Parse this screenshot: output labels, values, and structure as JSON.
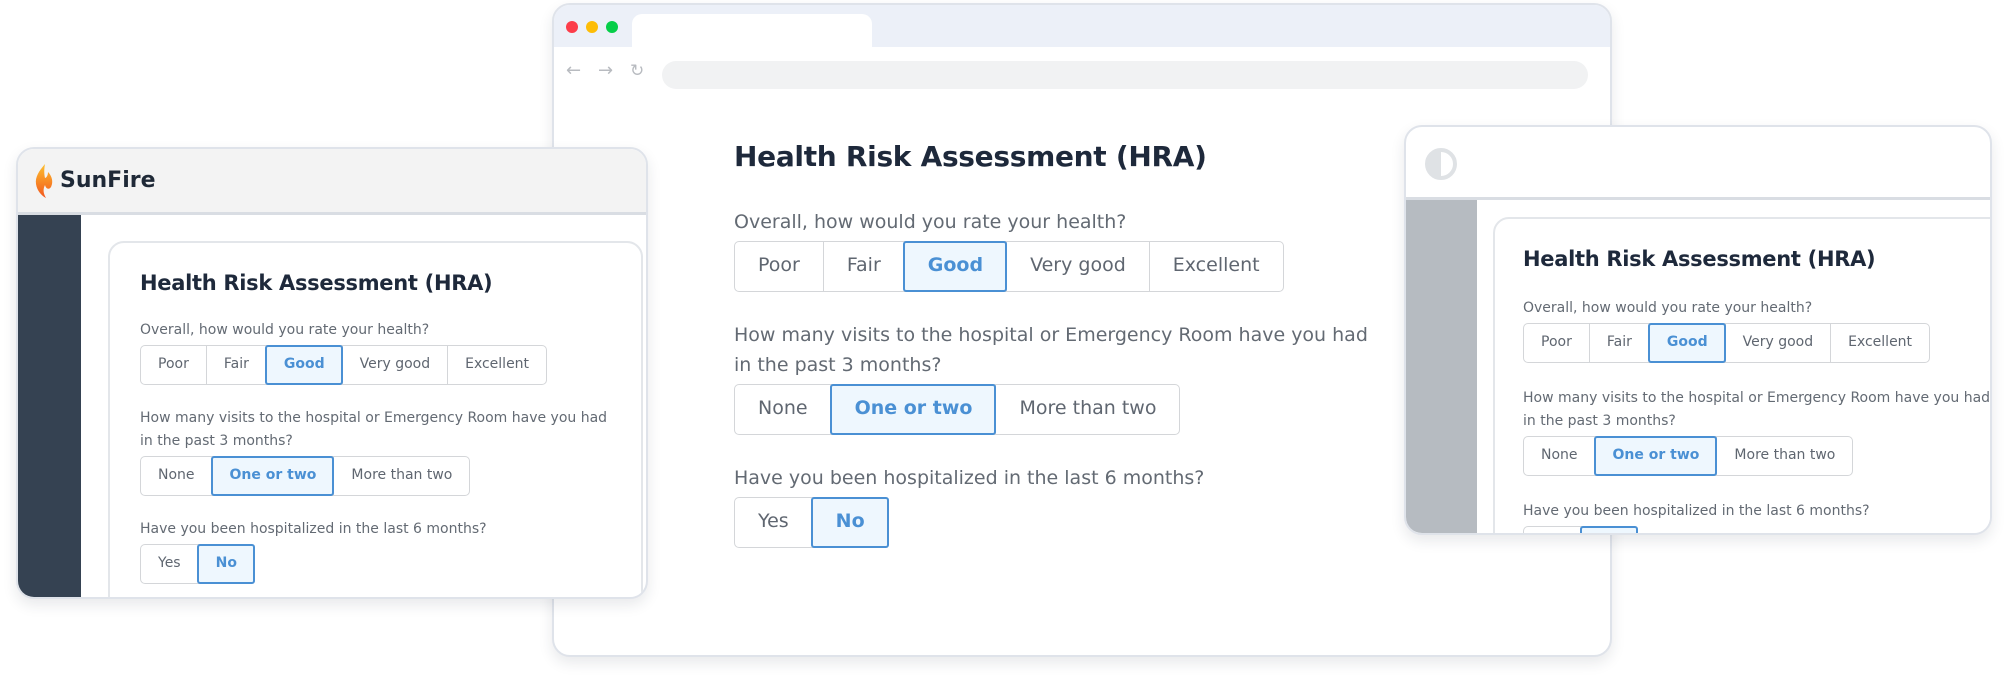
{
  "browser": {
    "traffic_lights": {
      "close": "#fc3d4a",
      "minimize": "#fdbd07",
      "maximize": "#06ce48"
    },
    "nav": {
      "back_icon": "←",
      "forward_icon": "→",
      "reload_icon": "↻"
    },
    "address": ""
  },
  "form": {
    "title": "Health Risk Assessment (HRA)",
    "questions": [
      {
        "label": "Overall, how would you rate your health?",
        "options": [
          "Poor",
          "Fair",
          "Good",
          "Very good",
          "Excellent"
        ],
        "selected": "Good"
      },
      {
        "label": "How many visits to the hospital or Emergency Room have you had in the past 3 months?",
        "options": [
          "None",
          "One or two",
          "More than two"
        ],
        "selected": "One or two"
      },
      {
        "label": "Have you been hospitalized in the last 6 months?",
        "options": [
          "Yes",
          "No"
        ],
        "selected": "No"
      }
    ]
  },
  "sunfire_window": {
    "brand": "SunFire",
    "sidebar_color": "#354252"
  },
  "right_window": {
    "logo_icon": "contrast-circle",
    "sidebar_color": "#b6bbc1"
  },
  "colors": {
    "accent": "#4a90d4",
    "selected_bg": "#eef7fe",
    "title": "#1e293b",
    "question": "#636a73"
  }
}
